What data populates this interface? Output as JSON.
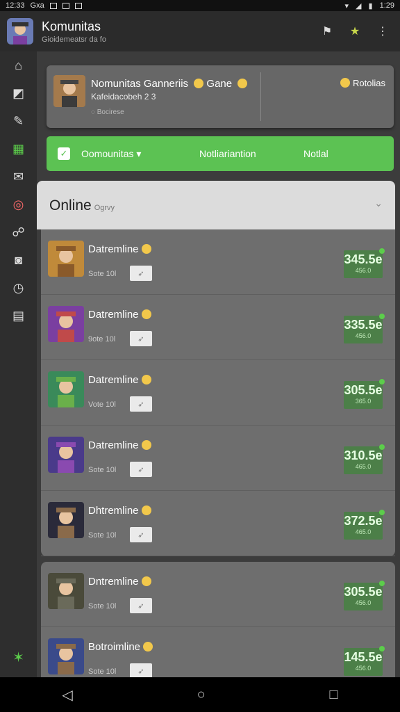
{
  "status": {
    "time_left": "12:33",
    "carrier": "Gxa",
    "time_right": "1:29"
  },
  "app": {
    "title": "Komunitas",
    "subtitle": "Gioidemeatsr da fo"
  },
  "profile_card": {
    "name": "Nomunitas Ganneriis",
    "tag": "Gane",
    "sub": "Kafeidacobeh 2 3",
    "meta": "Bocirese",
    "right_label": "Rotolias"
  },
  "tabs": [
    "Oomounitas",
    "Notliariantion",
    "Notlal"
  ],
  "online": {
    "label": "Online",
    "hint": "Ogrvy"
  },
  "rows": [
    {
      "name": "Datremline",
      "sub": "Sote 10l",
      "score": "345.5e",
      "score_sub": "456.0"
    },
    {
      "name": "Datremline",
      "sub": "9ote 10l",
      "score": "335.5e",
      "score_sub": "456.0"
    },
    {
      "name": "Datremline",
      "sub": "Vote 10l",
      "score": "305.5e",
      "score_sub": "365.0"
    },
    {
      "name": "Datremline",
      "sub": "Sote 10l",
      "score": "310.5e",
      "score_sub": "465.0"
    },
    {
      "name": "Dhtremline",
      "sub": "Sote 10l",
      "score": "372.5e",
      "score_sub": "465.0"
    },
    {
      "name": "Dntremline",
      "sub": "Sote 10l",
      "score": "305.5e",
      "score_sub": "456.0"
    },
    {
      "name": "Botroimline",
      "sub": "Sote 10l",
      "score": "145.5e",
      "score_sub": "456.0"
    }
  ],
  "colors": {
    "accent_green": "#5cc253",
    "score_bg": "#4c7f48"
  }
}
